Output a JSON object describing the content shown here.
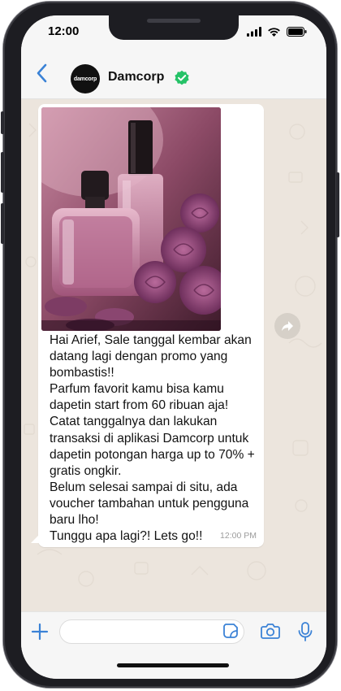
{
  "status_bar": {
    "time": "12:00"
  },
  "header": {
    "contact_name": "Damcorp",
    "avatar_text": "damcorp",
    "verified": true
  },
  "message": {
    "text": "Hai Arief, Sale tanggal kembar akan datang lagi dengan promo yang bombastis!!\nParfum favorit kamu bisa kamu dapetin start from 60 ribuan aja!\nCatat tanggalnya dan lakukan transaksi di aplikasi Damcorp untuk dapetin potongan harga up to 70% + gratis ongkir.\nBelum selesai sampai di situ, ada voucher tambahan untuk pengguna baru lho!\nTunggu apa lagi?! Lets go!!",
    "time": "12:00 PM",
    "image_subject": "perfume bottles with roses"
  },
  "composer": {
    "input_value": "",
    "placeholder": ""
  },
  "colors": {
    "accent": "#3b82d6",
    "verified_badge": "#25c267",
    "bubble": "#ffffff",
    "chat_background": "#ece5dd"
  },
  "icons": {
    "back": "chevron-left-icon",
    "forward": "forward-icon",
    "plus": "plus-icon",
    "sticker": "sticker-icon",
    "camera": "camera-icon",
    "mic": "mic-icon"
  }
}
